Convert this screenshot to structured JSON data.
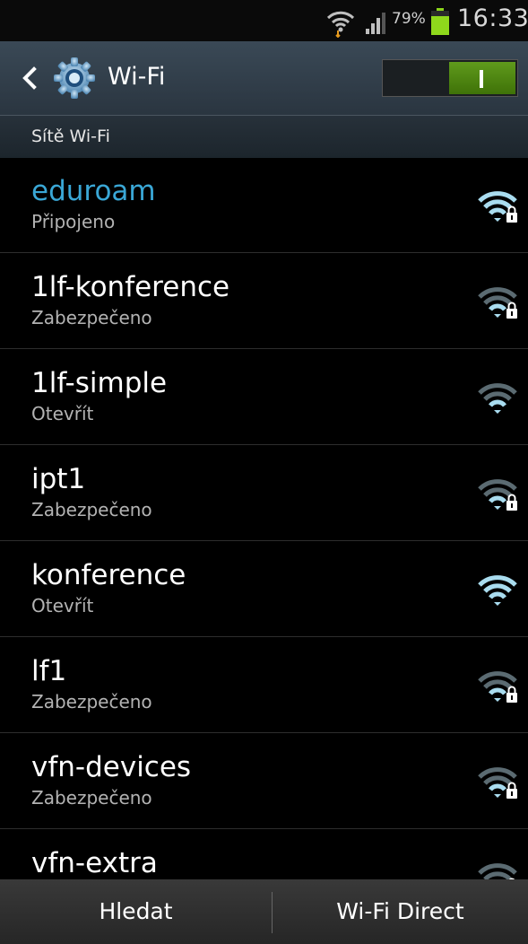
{
  "status_bar": {
    "battery_percent": "79%",
    "battery_level": 0.79,
    "time": "16:33",
    "wifi_icon": "wifi-transfer-icon",
    "signal_icon": "cell-signal-icon",
    "battery_color": "#8fd81c"
  },
  "header": {
    "back_icon": "chevron-left-icon",
    "app_icon": "gear-icon",
    "title": "Wi-Fi",
    "toggle_label": "I",
    "toggle_on": true
  },
  "section_title": "Sítě Wi-Fi",
  "networks": [
    {
      "name": "eduroam",
      "status": "Připojeno",
      "connected": true,
      "secured": true,
      "strength": 4
    },
    {
      "name": "1lf-konference",
      "status": "Zabezpečeno",
      "connected": false,
      "secured": true,
      "strength": 2
    },
    {
      "name": "1lf-simple",
      "status": "Otevřít",
      "connected": false,
      "secured": false,
      "strength": 2
    },
    {
      "name": "ipt1",
      "status": "Zabezpečeno",
      "connected": false,
      "secured": true,
      "strength": 2
    },
    {
      "name": "konference",
      "status": "Otevřít",
      "connected": false,
      "secured": false,
      "strength": 4
    },
    {
      "name": "lf1",
      "status": "Zabezpečeno",
      "connected": false,
      "secured": true,
      "strength": 2
    },
    {
      "name": "vfn-devices",
      "status": "Zabezpečeno",
      "connected": false,
      "secured": true,
      "strength": 2
    },
    {
      "name": "vfn-extra",
      "status": "",
      "connected": false,
      "secured": true,
      "strength": 2
    }
  ],
  "bottom_bar": {
    "left_label": "Hledat",
    "right_label": "Wi-Fi Direct"
  },
  "colors": {
    "connected_accent": "#3aa7d6",
    "toggle_on": "#5f9a1c",
    "wifi_active": "#a9dcef",
    "wifi_dim": "#5b6b72"
  }
}
